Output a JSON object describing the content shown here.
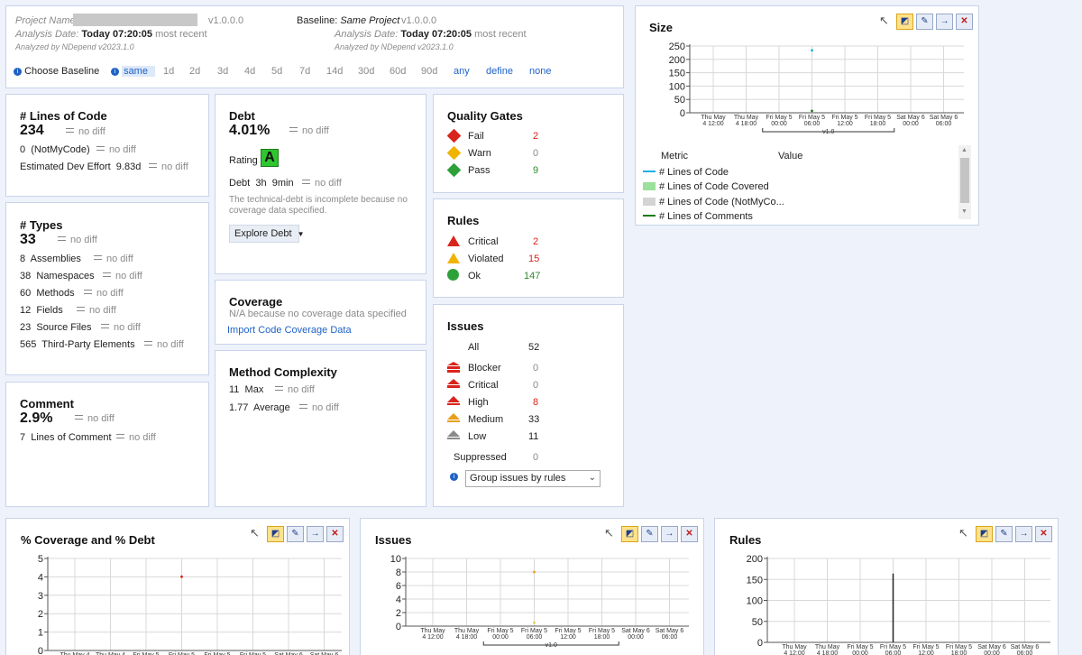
{
  "baseline_panel": {
    "project_label": "Project Name:",
    "version": "v1.0.0.0",
    "analysis_label": "Analysis Date:",
    "analysis_date": "Today 07:20:05",
    "most_recent": "most recent",
    "analyzed_by": "Analyzed by NDepend v2023.1.0",
    "baseline_label": "Baseline:",
    "baseline_name": "Same Project",
    "baseline_version": "v1.0.0.0",
    "choose_baseline": "Choose Baseline",
    "options": [
      "same",
      "1d",
      "2d",
      "3d",
      "4d",
      "5d",
      "7d",
      "14d",
      "30d",
      "60d",
      "90d",
      "any",
      "define",
      "none"
    ]
  },
  "loc": {
    "title": "# Lines of Code",
    "value": "234",
    "notmycode_value": "0",
    "notmycode_label": "(NotMyCode)",
    "effort_label": "Estimated Dev Effort",
    "effort_value": "9.83d",
    "no_diff": "no diff"
  },
  "types": {
    "title": "# Types",
    "value": "33",
    "rows": [
      {
        "value": "8",
        "label": "Assemblies"
      },
      {
        "value": "38",
        "label": "Namespaces"
      },
      {
        "value": "60",
        "label": "Methods"
      },
      {
        "value": "12",
        "label": "Fields"
      },
      {
        "value": "23",
        "label": "Source Files"
      },
      {
        "value": "565",
        "label": "Third-Party Elements"
      }
    ]
  },
  "comment": {
    "title": "Comment",
    "value": "2.9%",
    "lines_value": "7",
    "lines_label": "Lines of Comment"
  },
  "debt": {
    "title": "Debt",
    "value": "4.01%",
    "rating_label": "Rating",
    "rating": "A",
    "debt_label": "Debt",
    "debt_value": "3h",
    "debt_value2": "9min",
    "note": "The technical-debt is incomplete because no coverage data specified.",
    "explore": "Explore Debt"
  },
  "coverage": {
    "title": "Coverage",
    "note": "N/A because no coverage data specified",
    "import": "Import Code Coverage Data"
  },
  "complexity": {
    "title": "Method Complexity",
    "max_value": "11",
    "max_label": "Max",
    "avg_value": "1.77",
    "avg_label": "Average"
  },
  "quality_gates": {
    "title": "Quality Gates",
    "rows": [
      {
        "label": "Fail",
        "value": "2",
        "color": "#d9241c"
      },
      {
        "label": "Warn",
        "value": "0",
        "color": "#8a8a8a"
      },
      {
        "label": "Pass",
        "value": "9",
        "color": "#2c8a2c"
      }
    ]
  },
  "rules": {
    "title": "Rules",
    "rows": [
      {
        "label": "Critical",
        "value": "2",
        "color": "#d9241c"
      },
      {
        "label": "Violated",
        "value": "15",
        "color": "#d9241c"
      },
      {
        "label": "Ok",
        "value": "147",
        "color": "#2c8a2c"
      }
    ]
  },
  "issues": {
    "title": "Issues",
    "all_label": "All",
    "all_value": "52",
    "rows": [
      {
        "label": "Blocker",
        "value": "0",
        "color": "#8a8a8a"
      },
      {
        "label": "Critical",
        "value": "0",
        "color": "#8a8a8a"
      },
      {
        "label": "High",
        "value": "8",
        "color": "#d9241c"
      },
      {
        "label": "Medium",
        "value": "33",
        "color": "#222222"
      },
      {
        "label": "Low",
        "value": "11",
        "color": "#222222"
      }
    ],
    "suppressed_label": "Suppressed",
    "suppressed_value": "0",
    "group_by": "Group issues by rules"
  },
  "size_chart": {
    "title": "Size",
    "legend_header_metric": "Metric",
    "legend_header_value": "Value",
    "legend": [
      {
        "label": "# Lines of Code",
        "color": "#1ab0e8",
        "kind": "line"
      },
      {
        "label": "# Lines of Code Covered",
        "color": "#9be09b",
        "kind": "box"
      },
      {
        "label": "# Lines of Code (NotMyCo...",
        "color": "#d4d4d4",
        "kind": "box"
      },
      {
        "label": "# Lines of Comments",
        "color": "#1a7a1a",
        "kind": "line"
      }
    ]
  },
  "chart_data": [
    {
      "type": "scatter",
      "title": "Size",
      "y_ticks": [
        "250",
        "200",
        "150",
        "100",
        "50",
        "0"
      ],
      "ylim": [
        0,
        250
      ],
      "x_ticks": [
        [
          "Thu May",
          "4 12:00"
        ],
        [
          "Thu May",
          "4 18:00"
        ],
        [
          "Fri May 5",
          "00:00"
        ],
        [
          "Fri May 5",
          "06:00"
        ],
        [
          "Fri May 5",
          "12:00"
        ],
        [
          "Fri May 5",
          "18:00"
        ],
        [
          "Sat May 6",
          "00:00"
        ],
        [
          "Sat May 6",
          "06:00"
        ]
      ],
      "version_label": "v1.0",
      "series": [
        {
          "name": "# Lines of Code",
          "x": "Fri May 5 06:00",
          "y": 234,
          "color": "#1ab0e8"
        },
        {
          "name": "# Lines of Comments",
          "x": "Fri May 5 06:00",
          "y": 7,
          "color": "#1a7a1a"
        }
      ]
    },
    {
      "type": "scatter",
      "title": "% Coverage and % Debt",
      "y_ticks": [
        "5",
        "4",
        "3",
        "2",
        "1",
        "0"
      ],
      "ylim": [
        0,
        5
      ],
      "x_ticks": [
        [
          "Thu May 4",
          ""
        ],
        [
          "Thu May 4",
          ""
        ],
        [
          "Fri May 5",
          ""
        ],
        [
          "Fri May 5",
          ""
        ],
        [
          "Fri May 5",
          ""
        ],
        [
          "Fri May 5",
          ""
        ],
        [
          "Sat May 6",
          ""
        ],
        [
          "Sat May 6",
          ""
        ]
      ],
      "series": [
        {
          "name": "% Debt",
          "x": "Fri May 5 06:00",
          "y": 4.01,
          "color": "#d9241c"
        }
      ]
    },
    {
      "type": "scatter",
      "title": "Issues",
      "y_ticks": [
        "10",
        "8",
        "6",
        "4",
        "2",
        "0"
      ],
      "ylim": [
        0,
        10
      ],
      "x_ticks": [
        [
          "Thu May",
          "4 12:00"
        ],
        [
          "Thu May",
          "4 18:00"
        ],
        [
          "Fri May 5",
          "00:00"
        ],
        [
          "Fri May 5",
          "06:00"
        ],
        [
          "Fri May 5",
          "12:00"
        ],
        [
          "Fri May 5",
          "18:00"
        ],
        [
          "Sat May 6",
          "00:00"
        ],
        [
          "Sat May 6",
          "06:00"
        ]
      ],
      "version_label": "v1.0",
      "series": [
        {
          "name": "High",
          "x": "Fri May 5 06:00",
          "y": 8,
          "color": "#e8a01a"
        },
        {
          "name": "Low",
          "x": "Fri May 5 06:00",
          "y": 0.5,
          "color": "#e8c84a"
        }
      ]
    },
    {
      "type": "bar",
      "title": "Rules",
      "y_ticks": [
        "200",
        "150",
        "100",
        "50",
        "0"
      ],
      "ylim": [
        0,
        200
      ],
      "x_ticks": [
        [
          "Thu May",
          "4 12:00"
        ],
        [
          "Thu May",
          "4 18:00"
        ],
        [
          "Fri May 5",
          "00:00"
        ],
        [
          "Fri May 5",
          "06:00"
        ],
        [
          "Fri May 5",
          "12:00"
        ],
        [
          "Fri May 5",
          "18:00"
        ],
        [
          "Sat May 6",
          "00:00"
        ],
        [
          "Sat May 6",
          "06:00"
        ]
      ],
      "series": [
        {
          "name": "Ok",
          "x": "Fri May 5 06:00",
          "y": 164,
          "color": "#222222"
        }
      ]
    }
  ]
}
